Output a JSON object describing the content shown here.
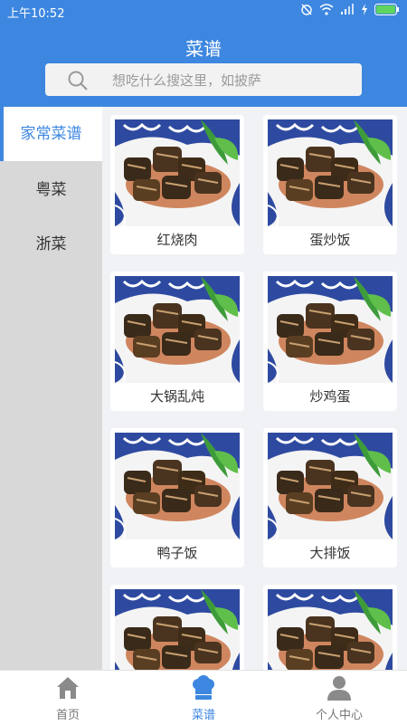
{
  "status_bar": {
    "time": "上午10:52"
  },
  "header": {
    "title": "菜谱"
  },
  "search": {
    "placeholder": "想吃什么搜这里，如披萨"
  },
  "sidebar": {
    "items": [
      {
        "label": "家常菜谱",
        "active": true
      },
      {
        "label": "粤菜",
        "active": false
      },
      {
        "label": "浙菜",
        "active": false
      }
    ]
  },
  "recipes": [
    {
      "name": "红烧肉"
    },
    {
      "name": "蛋炒饭"
    },
    {
      "name": "大锅乱炖"
    },
    {
      "name": "炒鸡蛋"
    },
    {
      "name": "鸭子饭"
    },
    {
      "name": "大排饭"
    },
    {
      "name": ""
    },
    {
      "name": ""
    }
  ],
  "tabbar": {
    "tabs": [
      {
        "label": "首页",
        "icon": "home-icon",
        "active": false
      },
      {
        "label": "菜谱",
        "icon": "chef-hat-icon",
        "active": true
      },
      {
        "label": "个人中心",
        "icon": "person-icon",
        "active": false
      }
    ]
  },
  "colors": {
    "primary": "#3d87e0",
    "sidebar_bg": "#d8d8d8",
    "content_bg": "#f0f2f5"
  }
}
